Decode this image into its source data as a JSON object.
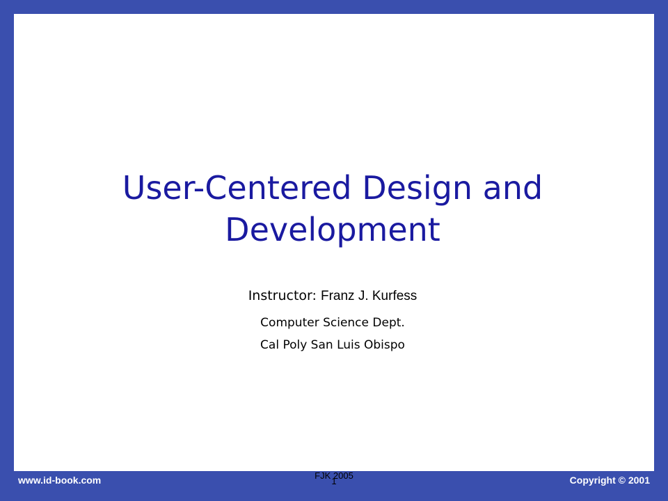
{
  "slide": {
    "title_line1": "User-Centered Design and",
    "title_line2": "Development",
    "instructor_label": "Instructor: ",
    "instructor_name": "Franz J. Kurfess",
    "department": "Computer Science Dept.",
    "university": "Cal Poly San Luis Obispo"
  },
  "footer": {
    "left": "www.id-book.com",
    "right": "Copyright © 2001",
    "center": "FJK 2005",
    "page_number": "1"
  },
  "colors": {
    "border": "#3a4fae",
    "title": "#1a1aa0",
    "background": "#ffffff"
  }
}
